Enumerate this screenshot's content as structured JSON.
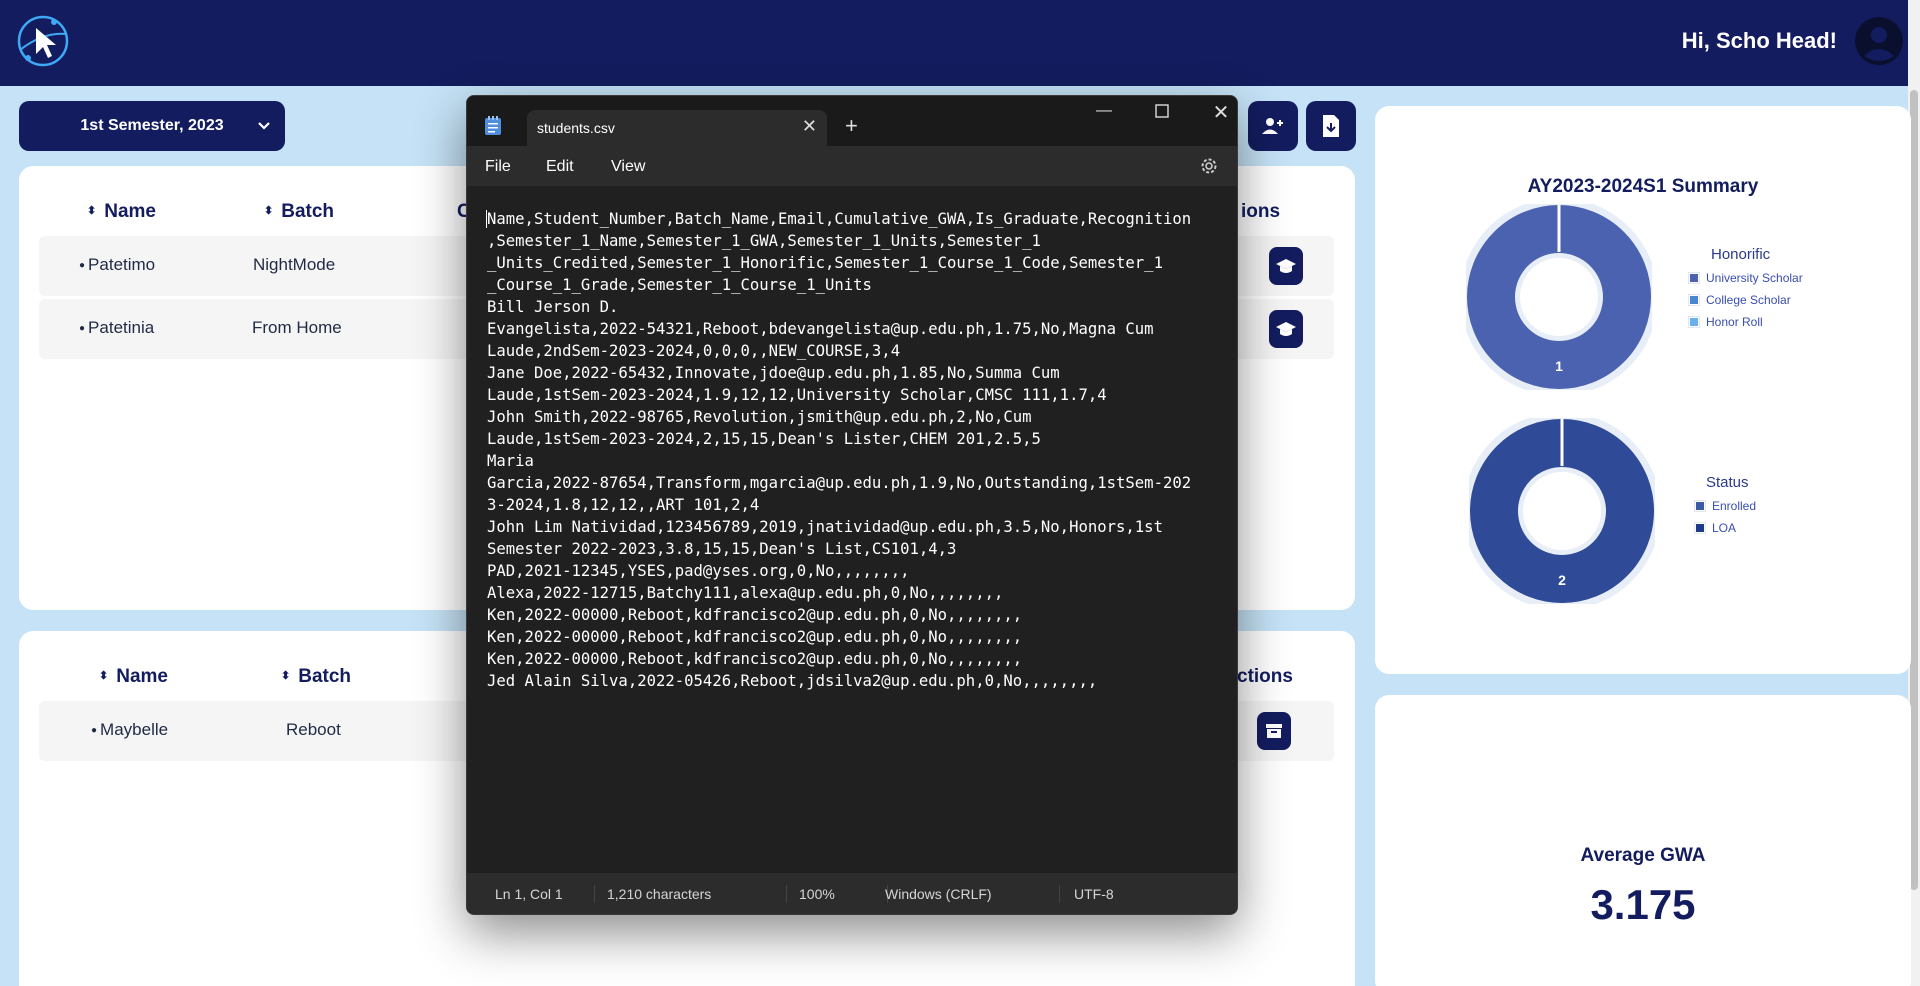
{
  "header": {
    "greeting": "Hi, Scho Head!"
  },
  "semester_selector": {
    "value": "1st Semester, 2023"
  },
  "graduates_table": {
    "columns": [
      "Name",
      "Batch"
    ],
    "actions_partial": "ions",
    "partial_column": "C",
    "rows": [
      {
        "name": "Patetimo",
        "batch": "NightMode"
      },
      {
        "name": "Patetinia",
        "batch": "From Home"
      }
    ]
  },
  "archive_table": {
    "columns": [
      "Name",
      "Batch"
    ],
    "actions_partial": "ctions",
    "rows": [
      {
        "name": "Maybelle",
        "batch": "Reboot"
      }
    ]
  },
  "summary_panel": {
    "title": "AY2023-2024S1 Summary",
    "honorific_chart": {
      "legend_title": "Honorific",
      "items": [
        "University Scholar",
        "College Scholar",
        "Honor Roll"
      ],
      "colors": [
        "#4a62b0",
        "#4d86d0",
        "#69b0ee"
      ],
      "value_label": "1"
    },
    "status_chart": {
      "legend_title": "Status",
      "items": [
        "Enrolled",
        "LOA"
      ],
      "colors": [
        "#3b5aa8",
        "#1e3a8a"
      ],
      "value_label": "2"
    }
  },
  "chart_data": [
    {
      "type": "pie",
      "title": "AY2023-2024S1 Summary",
      "legend_title": "Honorific",
      "categories": [
        "University Scholar",
        "College Scholar",
        "Honor Roll"
      ],
      "values": [
        1,
        0,
        0
      ]
    },
    {
      "type": "pie",
      "legend_title": "Status",
      "categories": [
        "Enrolled",
        "LOA"
      ],
      "values": [
        2,
        0
      ]
    }
  ],
  "gwa_panel": {
    "label": "Average GWA",
    "value": "3.175"
  },
  "notepad": {
    "tab_title": "students.csv",
    "menu": {
      "file": "File",
      "edit": "Edit",
      "view": "View"
    },
    "content": "Name,Student_Number,Batch_Name,Email,Cumulative_GWA,Is_Graduate,Recognition\n,Semester_1_Name,Semester_1_GWA,Semester_1_Units,Semester_1\n_Units_Credited,Semester_1_Honorific,Semester_1_Course_1_Code,Semester_1\n_Course_1_Grade,Semester_1_Course_1_Units\nBill Jerson D.\nEvangelista,2022-54321,Reboot,bdevangelista@up.edu.ph,1.75,No,Magna Cum\nLaude,2ndSem-2023-2024,0,0,0,,NEW_COURSE,3,4\nJane Doe,2022-65432,Innovate,jdoe@up.edu.ph,1.85,No,Summa Cum\nLaude,1stSem-2023-2024,1.9,12,12,University Scholar,CMSC 111,1.7,4\nJohn Smith,2022-98765,Revolution,jsmith@up.edu.ph,2,No,Cum\nLaude,1stSem-2023-2024,2,15,15,Dean's Lister,CHEM 201,2.5,5\nMaria\nGarcia,2022-87654,Transform,mgarcia@up.edu.ph,1.9,No,Outstanding,1stSem-202\n3-2024,1.8,12,12,,ART 101,2,4\nJohn Lim Natividad,123456789,2019,jnatividad@up.edu.ph,3.5,No,Honors,1st\nSemester 2022-2023,3.8,15,15,Dean's List,CS101,4,3\nPAD,2021-12345,YSES,pad@yses.org,0,No,,,,,,,,\nAlexa,2022-12715,Batchy111,alexa@up.edu.ph,0,No,,,,,,,,\nKen,2022-00000,Reboot,kdfrancisco2@up.edu.ph,0,No,,,,,,,,\nKen,2022-00000,Reboot,kdfrancisco2@up.edu.ph,0,No,,,,,,,,\nKen,2022-00000,Reboot,kdfrancisco2@up.edu.ph,0,No,,,,,,,,\nJed Alain Silva,2022-05426,Reboot,jdsilva2@up.edu.ph,0,No,,,,,,,,",
    "status": {
      "position": "Ln 1, Col 1",
      "characters": "1,210 characters",
      "zoom": "100%",
      "line_ending": "Windows (CRLF)",
      "encoding": "UTF-8"
    }
  }
}
